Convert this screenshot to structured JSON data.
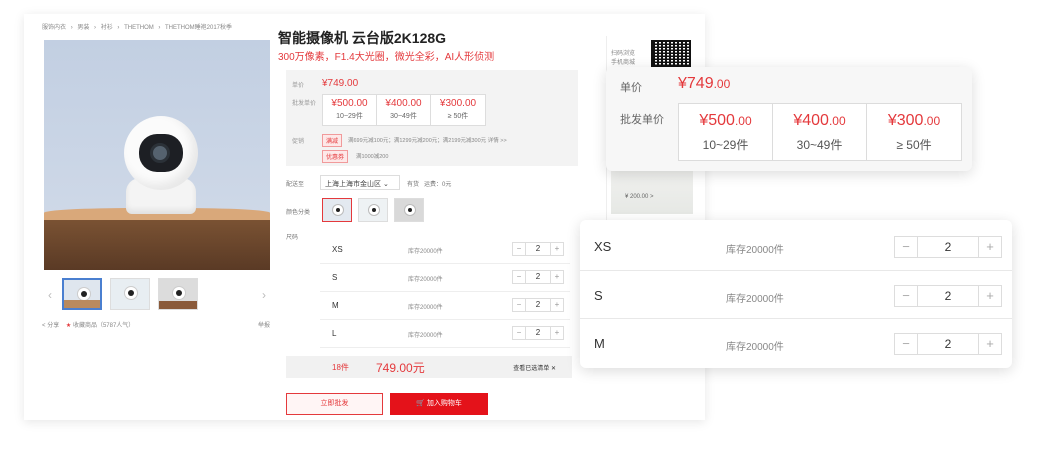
{
  "breadcrumb": [
    "服饰内衣",
    "›",
    "男装",
    "›",
    "衬衫",
    "›",
    "THETHOM",
    "›",
    "THETHOM睡袍2017秋季"
  ],
  "product": {
    "title": "智能摄像机 云台版2K128G",
    "subtitle": "300万像素，F1.4大光圈，微光全彩，AI人形侦测"
  },
  "gallery": {
    "prev_arrow": "‹",
    "next_arrow": "›",
    "share": "分享",
    "favorite": "收藏商品（5787人气）",
    "report": "举报"
  },
  "pricing": {
    "unit_label": "单价",
    "unit_price": "¥749.00",
    "wholesale_label": "批发单价",
    "tiers": [
      {
        "price": "¥500.00",
        "qty": "10~29件"
      },
      {
        "price": "¥400.00",
        "qty": "30~49件"
      },
      {
        "price": "¥300.00",
        "qty": "≥ 50件"
      }
    ],
    "promo_label": "促销",
    "promo_tag_1": "满减",
    "promo_text_1": "满699元减100元；满1299元减200元；满2199元减300元 详情 >>",
    "promo_tag_2": "优惠券",
    "promo_text_2": "满1000减200"
  },
  "popup_price": {
    "unit_label": "单价",
    "unit_price_main": "¥749",
    "unit_price_cents": ".00",
    "wholesale_label": "批发单价",
    "tiers": [
      {
        "main": "¥500",
        "cents": ".00",
        "qty": "10~29件"
      },
      {
        "main": "¥400",
        "cents": ".00",
        "qty": "30~49件"
      },
      {
        "main": "¥300",
        "cents": ".00",
        "qty": "≥ 50件"
      }
    ]
  },
  "options": {
    "ship_label": "配送至",
    "region": "上海上海市金山区 ⌄",
    "stock_status": "有货",
    "shipping_fee": "运费：0元",
    "color_label": "颜色分类",
    "size_label": "尺码"
  },
  "sizes": [
    {
      "size": "XS",
      "stock": "库存20000件",
      "qty": "2"
    },
    {
      "size": "S",
      "stock": "库存20000件",
      "qty": "2"
    },
    {
      "size": "M",
      "stock": "库存20000件",
      "qty": "2"
    },
    {
      "size": "L",
      "stock": "库存20000件",
      "qty": "2"
    }
  ],
  "popup_sizes": [
    {
      "size": "XS",
      "stock": "库存20000件",
      "qty": "2"
    },
    {
      "size": "S",
      "stock": "库存20000件",
      "qty": "2"
    },
    {
      "size": "M",
      "stock": "库存20000件",
      "qty": "2"
    }
  ],
  "stepper": {
    "minus": "−",
    "plus": "+"
  },
  "summary": {
    "count": "18件",
    "total": "749.00元",
    "view_list": "查看已选清单 ✕"
  },
  "actions": {
    "wholesale": "立即批发",
    "cart": "🛒 加入购物车"
  },
  "side": {
    "qr_label_1": "扫码浏览",
    "qr_label_2": "手机商城",
    "related_price": "¥ 200.00 >"
  },
  "colors": {
    "accent": "#e4393c",
    "cart_button": "#e4121a"
  }
}
